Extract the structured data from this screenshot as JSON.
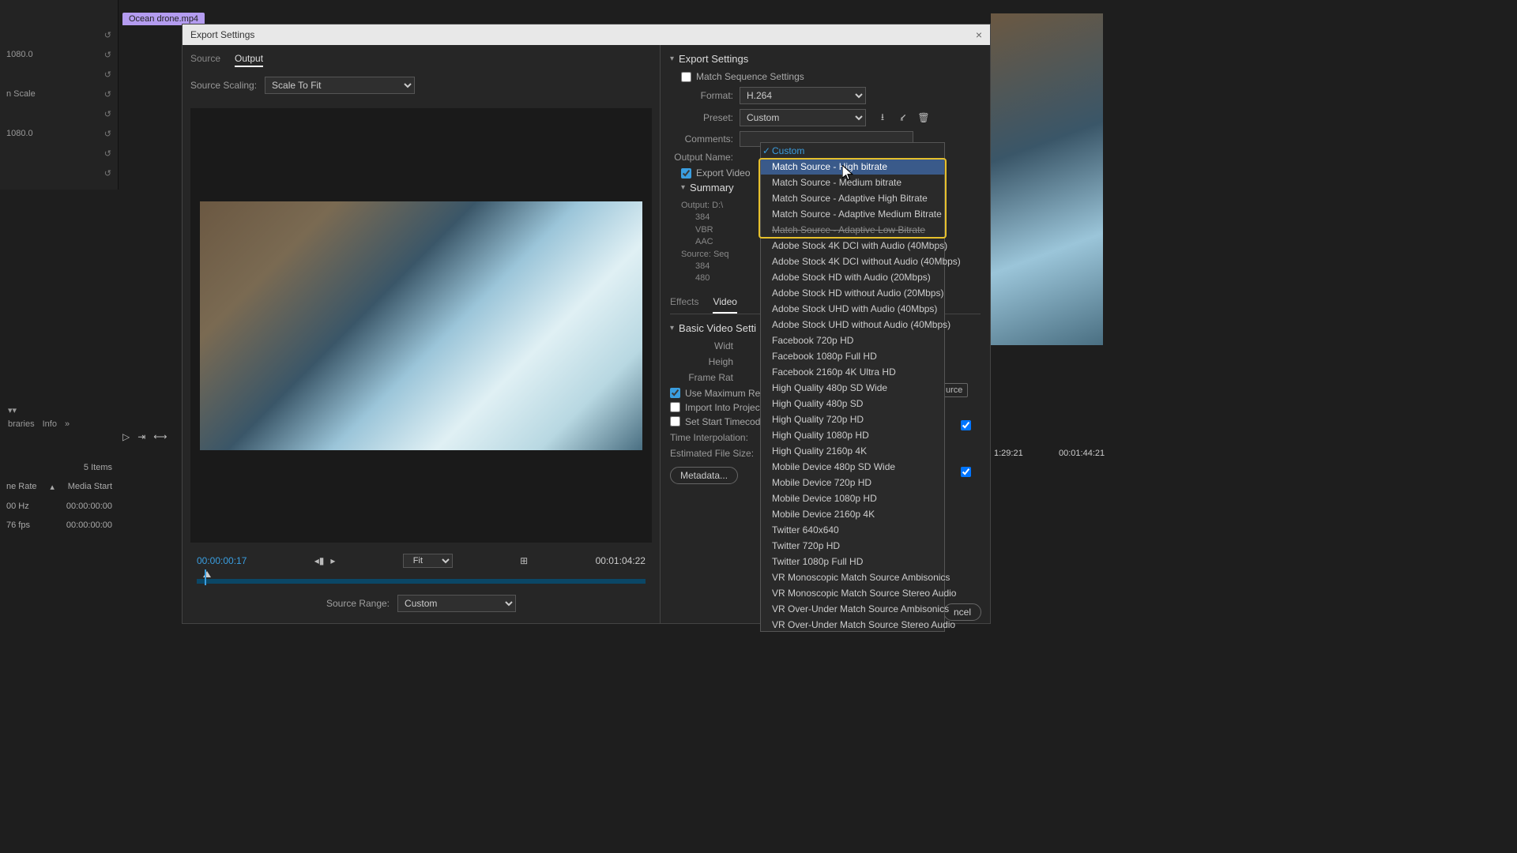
{
  "clipTab": "Ocean drone.mp4",
  "leftPanel": {
    "r1": "1080.0",
    "r2": "n Scale",
    "r3": "1080.0"
  },
  "dialog": {
    "title": "Export Settings",
    "tabs": {
      "source": "Source",
      "output": "Output"
    },
    "sourceScalingLabel": "Source Scaling:",
    "sourceScaling": "Scale To Fit",
    "timecode": "00:00:00:17",
    "fit": "Fit",
    "duration": "00:01:04:22",
    "sourceRangeLabel": "Source Range:",
    "sourceRange": "Custom"
  },
  "settings": {
    "header": "Export Settings",
    "matchSeq": "Match Sequence Settings",
    "formatLabel": "Format:",
    "format": "H.264",
    "presetLabel": "Preset:",
    "preset": "Custom",
    "commentsLabel": "Comments:",
    "outputNameLabel": "Output Name:",
    "exportVideo": "Export Video",
    "summaryLabel": "Summary",
    "outputLine": "Output: D:\\",
    "out2": "384",
    "out3": "VBR",
    "out4": "AAC",
    "sourceLine": "Source: Seq",
    "src2": "384",
    "src3": "480",
    "effectsTab": "Effects",
    "videoTab": "Video",
    "basicVideo": "Basic Video Setti",
    "widthLabel": "Widt",
    "heightLabel": "Heigh",
    "frameRateLabel": "Frame Rat",
    "useMaxRender": "Use Maximum Ren",
    "importProject": "Import Into Project",
    "setStartTC": "Set Start Timecode",
    "timeInterpLabel": "Time Interpolation:",
    "estFileSize": "Estimated File Size:",
    "metadataBtn": "Metadata..."
  },
  "presetList": [
    {
      "label": "Custom",
      "selected": true
    },
    {
      "label": "Match Source - High bitrate",
      "hover": true
    },
    {
      "label": "Match Source - Medium bitrate"
    },
    {
      "label": "Match Source - Adaptive High Bitrate"
    },
    {
      "label": "Match Source - Adaptive Medium Bitrate"
    },
    {
      "label": "Match Source - Adaptive Low Bitrate",
      "struck": true
    },
    {
      "label": "Adobe Stock 4K DCI with Audio (40Mbps)"
    },
    {
      "label": "Adobe Stock 4K DCI without Audio (40Mbps)"
    },
    {
      "label": "Adobe Stock HD with Audio (20Mbps)"
    },
    {
      "label": "Adobe Stock HD without Audio (20Mbps)"
    },
    {
      "label": "Adobe Stock UHD with Audio (40Mbps)"
    },
    {
      "label": "Adobe Stock UHD without Audio (40Mbps)"
    },
    {
      "label": "Facebook 720p HD"
    },
    {
      "label": "Facebook 1080p Full HD"
    },
    {
      "label": "Facebook 2160p 4K Ultra HD"
    },
    {
      "label": "High Quality 480p SD Wide"
    },
    {
      "label": "High Quality 480p SD"
    },
    {
      "label": "High Quality 720p HD"
    },
    {
      "label": "High Quality 1080p HD"
    },
    {
      "label": "High Quality 2160p 4K"
    },
    {
      "label": "Mobile Device 480p SD Wide"
    },
    {
      "label": "Mobile Device 720p HD"
    },
    {
      "label": "Mobile Device 1080p HD"
    },
    {
      "label": "Mobile Device 2160p 4K"
    },
    {
      "label": "Twitter 640x640"
    },
    {
      "label": "Twitter 720p HD"
    },
    {
      "label": "Twitter 1080p Full HD"
    },
    {
      "label": "VR Monoscopic Match Source Ambisonics"
    },
    {
      "label": "VR Monoscopic Match Source Stereo Audio"
    },
    {
      "label": "VR Over-Under Match Source Ambisonics"
    },
    {
      "label": "VR Over-Under Match Source Stereo Audio"
    }
  ],
  "rightSide": {
    "tc1": "1:29:21",
    "tc2": "00:01:44:21",
    "urceBtn": "urce",
    "cancel": "ncel"
  },
  "bottom": {
    "items": "5 Items",
    "rateLabel": "ne Rate",
    "mediaStart": "Media Start",
    "hz": "00 Hz",
    "zero": "00:00:00:00",
    "fps": "76 fps",
    "info": "Info",
    "libraries": "braries"
  }
}
